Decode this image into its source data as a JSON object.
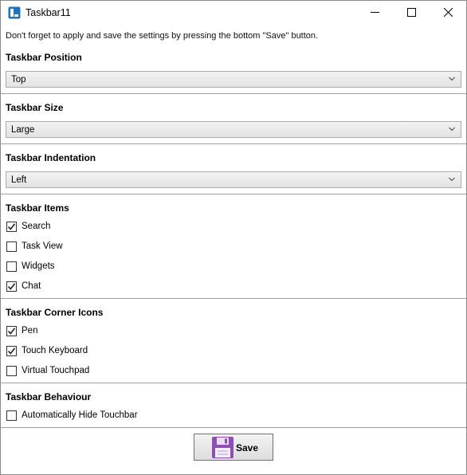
{
  "window": {
    "title": "Taskbar11"
  },
  "note": "Don't forget to apply and save the settings by pressing the bottom \"Save\" button.",
  "sections": {
    "position": {
      "title": "Taskbar Position",
      "selected": "Top"
    },
    "size": {
      "title": "Taskbar Size",
      "selected": "Large"
    },
    "indentation": {
      "title": "Taskbar Indentation",
      "selected": "Left"
    },
    "items": {
      "title": "Taskbar Items",
      "options": [
        {
          "label": "Search",
          "checked": true
        },
        {
          "label": "Task View",
          "checked": false
        },
        {
          "label": "Widgets",
          "checked": false
        },
        {
          "label": "Chat",
          "checked": true
        }
      ]
    },
    "corner_icons": {
      "title": "Taskbar Corner Icons",
      "options": [
        {
          "label": "Pen",
          "checked": true
        },
        {
          "label": "Touch Keyboard",
          "checked": true
        },
        {
          "label": "Virtual Touchpad",
          "checked": false
        }
      ]
    },
    "behaviour": {
      "title": "Taskbar Behaviour",
      "options": [
        {
          "label": "Automatically Hide Touchbar",
          "checked": false
        }
      ]
    }
  },
  "save_button": {
    "label": "Save"
  },
  "colors": {
    "app_icon": "#1e73be",
    "save_icon": "#8e4fb5"
  },
  "icons": {
    "app": "taskbar-app-icon",
    "save": "floppy-disk-icon"
  }
}
